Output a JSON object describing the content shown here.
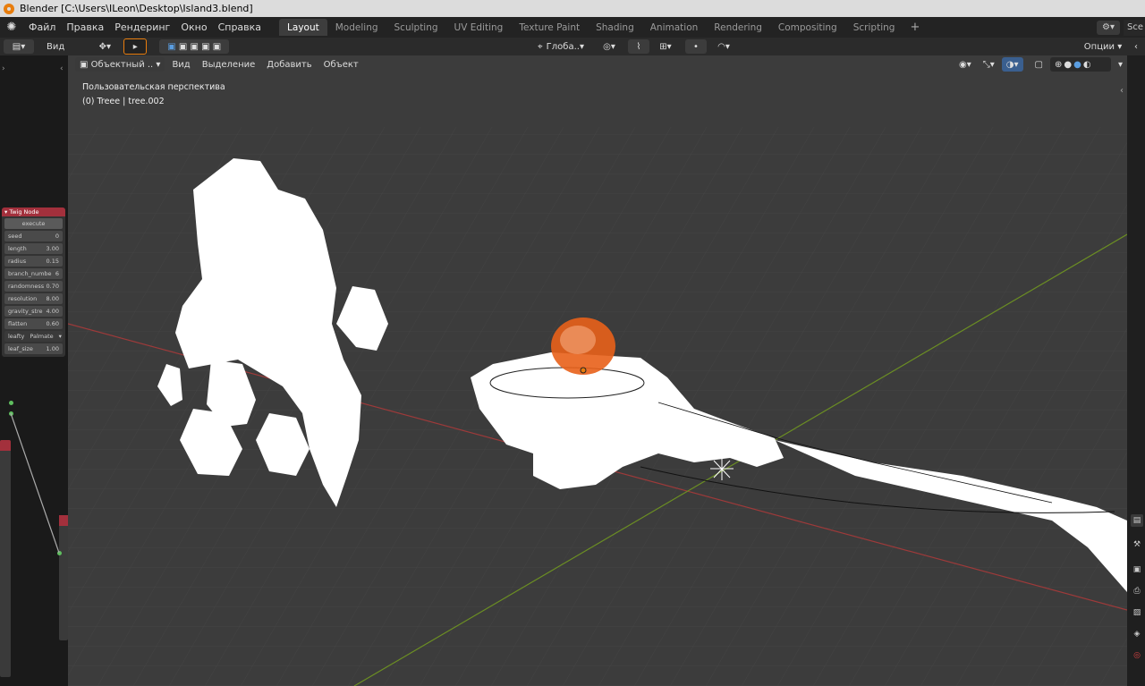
{
  "window": {
    "title": "Blender [C:\\Users\\ILeon\\Desktop\\Island3.blend]"
  },
  "menu": [
    "Файл",
    "Правка",
    "Рендеринг",
    "Окно",
    "Справка"
  ],
  "workspaces": {
    "active": "Layout",
    "tabs": [
      "Layout",
      "Modeling",
      "Sculpting",
      "UV Editing",
      "Texture Paint",
      "Shading",
      "Animation",
      "Rendering",
      "Compositing",
      "Scripting"
    ],
    "add_symbol": "+"
  },
  "scene": {
    "label": "Sce"
  },
  "tool_header": {
    "view_label": "Вид",
    "orientation_label": "Глоба..",
    "options_label": "Опции"
  },
  "viewport": {
    "mode_label": "Объектный ..",
    "menu": [
      "Вид",
      "Выделение",
      "Добавить",
      "Объект"
    ],
    "perspective_text": "Пользовательская перспектива",
    "object_text": "(0) Treee | tree.002"
  },
  "twig_node": {
    "title": "Twig Node",
    "execute_label": "execute",
    "fields": [
      {
        "label": "seed",
        "value": "0"
      },
      {
        "label": "length",
        "value": "3.00"
      },
      {
        "label": "radius",
        "value": "0.15"
      },
      {
        "label": "branch_numbe",
        "value": "6"
      },
      {
        "label": "randomness",
        "value": "0.70"
      },
      {
        "label": "resolution",
        "value": "8.00"
      },
      {
        "label": "gravity_stre",
        "value": "4.00"
      },
      {
        "label": "flatten",
        "value": "0.60"
      }
    ],
    "leafty_label": "leafty",
    "leafty_value": "Palmate",
    "leaf_size_label": "leaf_size",
    "leaf_size_value": "1.00"
  },
  "colors": {
    "accent": "#e87d0d",
    "node_header": "#a3303c",
    "x_axis": "#9d3a3a",
    "y_axis": "#6b8e23",
    "viewport_bg": "#3c3c3c"
  }
}
